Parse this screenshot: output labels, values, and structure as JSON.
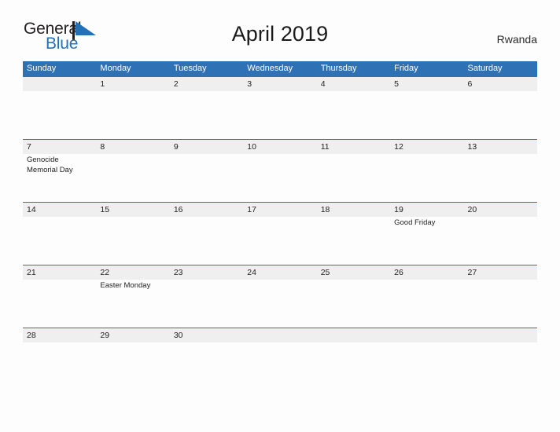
{
  "brand": {
    "name_part1": "General",
    "name_part2": "Blue",
    "mark": "triangle-flag-icon",
    "color_dark": "#231f20",
    "color_blue": "#2470b7"
  },
  "header": {
    "title": "April 2019",
    "country": "Rwanda"
  },
  "theme": {
    "header_bar": "#2e71b5",
    "row_band": "#efefef",
    "page_background": "#fdfdfd",
    "text": "#222222"
  },
  "calendar": {
    "weekdays": [
      "Sunday",
      "Monday",
      "Tuesday",
      "Wednesday",
      "Thursday",
      "Friday",
      "Saturday"
    ],
    "weeks": [
      [
        {
          "day": "",
          "event": ""
        },
        {
          "day": "1",
          "event": ""
        },
        {
          "day": "2",
          "event": ""
        },
        {
          "day": "3",
          "event": ""
        },
        {
          "day": "4",
          "event": ""
        },
        {
          "day": "5",
          "event": ""
        },
        {
          "day": "6",
          "event": ""
        }
      ],
      [
        {
          "day": "7",
          "event": "Genocide\nMemorial Day"
        },
        {
          "day": "8",
          "event": ""
        },
        {
          "day": "9",
          "event": ""
        },
        {
          "day": "10",
          "event": ""
        },
        {
          "day": "11",
          "event": ""
        },
        {
          "day": "12",
          "event": ""
        },
        {
          "day": "13",
          "event": ""
        }
      ],
      [
        {
          "day": "14",
          "event": ""
        },
        {
          "day": "15",
          "event": ""
        },
        {
          "day": "16",
          "event": ""
        },
        {
          "day": "17",
          "event": ""
        },
        {
          "day": "18",
          "event": ""
        },
        {
          "day": "19",
          "event": "Good Friday"
        },
        {
          "day": "20",
          "event": ""
        }
      ],
      [
        {
          "day": "21",
          "event": ""
        },
        {
          "day": "22",
          "event": "Easter Monday"
        },
        {
          "day": "23",
          "event": ""
        },
        {
          "day": "24",
          "event": ""
        },
        {
          "day": "25",
          "event": ""
        },
        {
          "day": "26",
          "event": ""
        },
        {
          "day": "27",
          "event": ""
        }
      ],
      [
        {
          "day": "28",
          "event": ""
        },
        {
          "day": "29",
          "event": ""
        },
        {
          "day": "30",
          "event": ""
        },
        {
          "day": "",
          "event": ""
        },
        {
          "day": "",
          "event": ""
        },
        {
          "day": "",
          "event": ""
        },
        {
          "day": "",
          "event": ""
        }
      ]
    ]
  }
}
